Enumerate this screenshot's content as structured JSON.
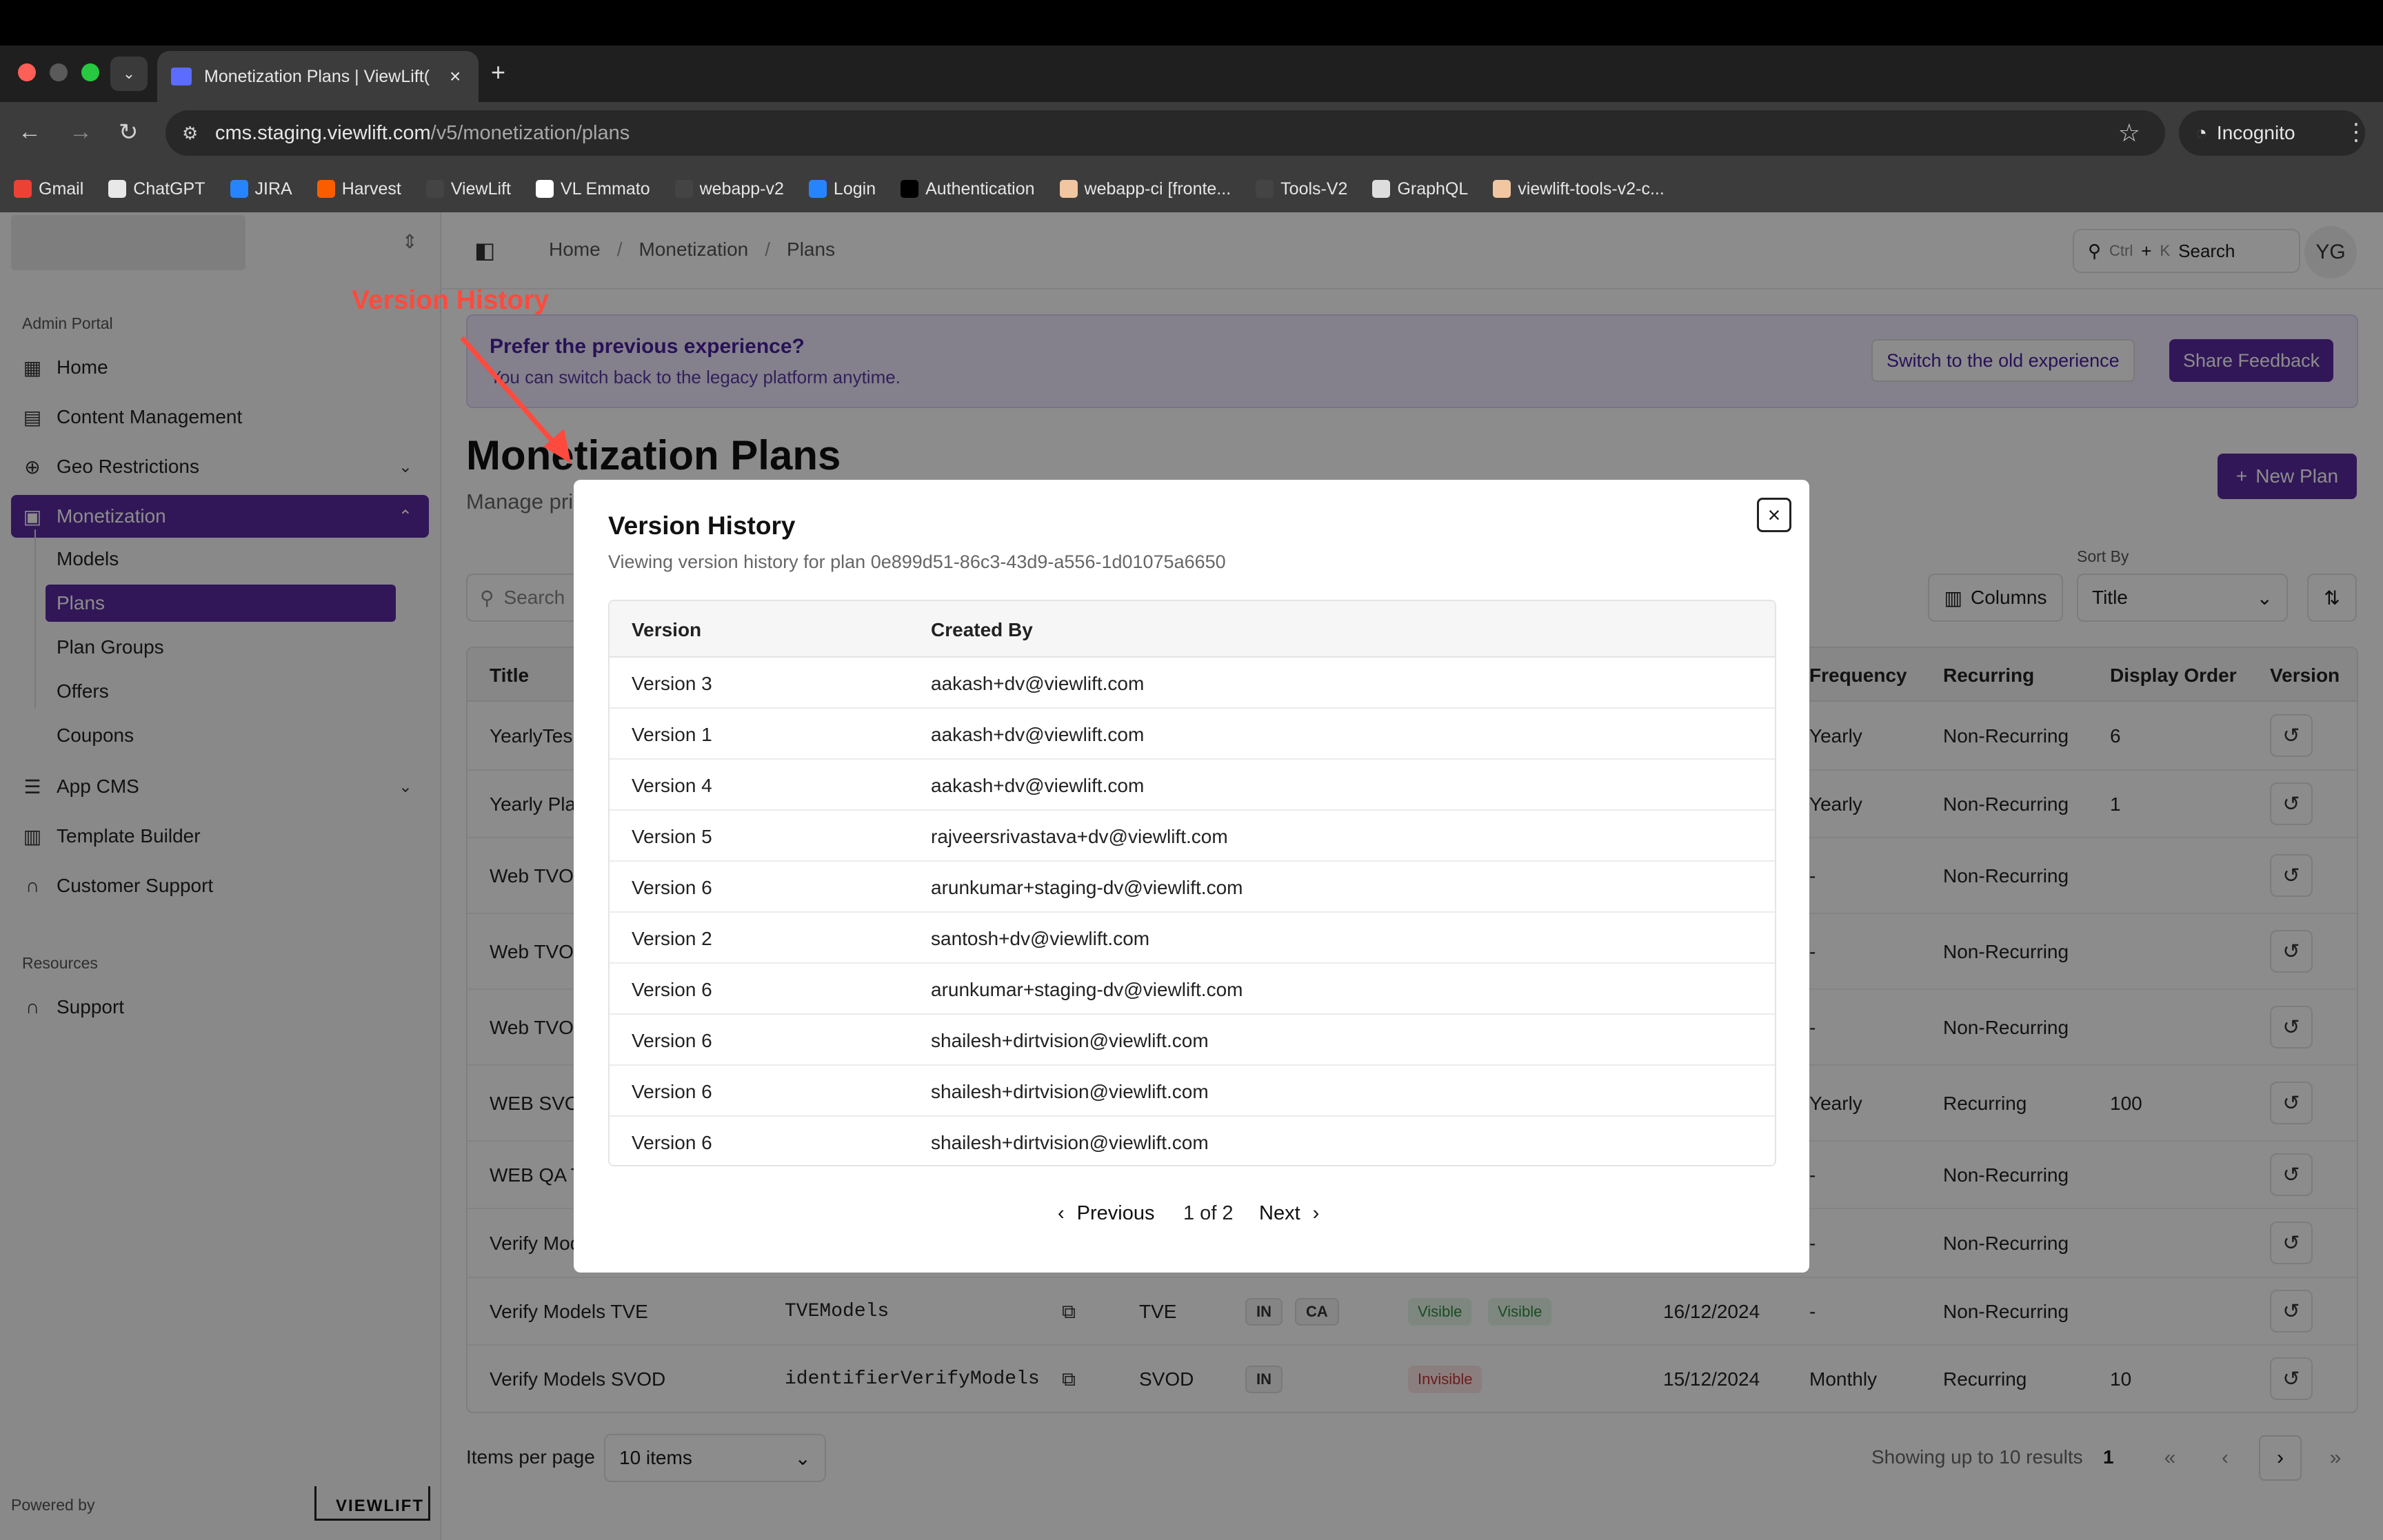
{
  "browser": {
    "tab_title": "Monetization Plans | ViewLift(",
    "url_host": "cms.staging.viewlift.com",
    "url_path": "/v5/monetization/plans",
    "incognito_label": "Incognito",
    "bookmarks": [
      {
        "label": "Gmail",
        "color": "#ea4335"
      },
      {
        "label": "ChatGPT",
        "color": "#e8e8e8"
      },
      {
        "label": "JIRA",
        "color": "#2684ff"
      },
      {
        "label": "Harvest",
        "color": "#fa5d00"
      },
      {
        "label": "ViewLift",
        "color": "#444444"
      },
      {
        "label": "VL Emmato",
        "color": "#ffffff"
      },
      {
        "label": "webapp-v2",
        "color": "#444444"
      },
      {
        "label": "Login",
        "color": "#2684ff"
      },
      {
        "label": "Authentication",
        "color": "#000000"
      },
      {
        "label": "webapp-ci [fronte...",
        "color": "#f2c6a0"
      },
      {
        "label": "Tools-V2",
        "color": "#444444"
      },
      {
        "label": "GraphQL",
        "color": "#dddddd"
      },
      {
        "label": "viewlift-tools-v2-c...",
        "color": "#f2c6a0"
      }
    ]
  },
  "sidebar": {
    "section_admin": "Admin Portal",
    "items": [
      {
        "label": "Home"
      },
      {
        "label": "Content Management"
      },
      {
        "label": "Geo Restrictions"
      },
      {
        "label": "Monetization"
      },
      {
        "label": "App CMS"
      },
      {
        "label": "Template Builder"
      },
      {
        "label": "Customer Support"
      }
    ],
    "sub_items": [
      "Models",
      "Plans",
      "Plan Groups",
      "Offers",
      "Coupons"
    ],
    "section_resources": "Resources",
    "support": "Support",
    "powered_by": "Powered by",
    "brand": "VIEWLIFT"
  },
  "header": {
    "breadcrumbs": [
      "Home",
      "Monetization",
      "Plans"
    ],
    "search_ctrl": "Ctrl",
    "search_plus": "+",
    "search_k": "K",
    "search_label": "Search",
    "avatar": "YG"
  },
  "banner": {
    "title": "Prefer the previous experience?",
    "subtitle": "You can switch back to the legacy platform anytime.",
    "switch_label": "Switch to the old experience",
    "feedback_label": "Share Feedback"
  },
  "page": {
    "title": "Monetization Plans",
    "subtitle": "Manage pri",
    "new_plan": "New Plan",
    "search_placeholder": "Search",
    "columns_label": "Columns",
    "sort_by_label": "Sort By",
    "sort_value": "Title"
  },
  "plans_table": {
    "headers": {
      "title": "Title",
      "frequency": "Frequency",
      "recurring": "Recurring",
      "display_order": "Display Order",
      "version": "Version"
    },
    "rows": [
      {
        "title": "YearlyTes",
        "identifier": "",
        "type": "",
        "countries": [],
        "visibility": [],
        "date": "",
        "frequency": "Yearly",
        "recurring": "Non-Recurring",
        "order": "6"
      },
      {
        "title": "Yearly Pla",
        "identifier": "",
        "type": "",
        "countries": [],
        "visibility": [],
        "date": "",
        "frequency": "Yearly",
        "recurring": "Non-Recurring",
        "order": "1"
      },
      {
        "title": "Web TVOD",
        "identifier": "",
        "type": "",
        "countries": [],
        "visibility": [],
        "date": "",
        "frequency": "-",
        "recurring": "Non-Recurring",
        "order": ""
      },
      {
        "title": "Web TVOD",
        "identifier": "",
        "type": "",
        "countries": [],
        "visibility": [],
        "date": "",
        "frequency": "-",
        "recurring": "Non-Recurring",
        "order": ""
      },
      {
        "title": "Web TVOD",
        "identifier": "",
        "type": "",
        "countries": [],
        "visibility": [],
        "date": "",
        "frequency": "-",
        "recurring": "Non-Recurring",
        "order": ""
      },
      {
        "title": "WEB SVOD",
        "identifier": "",
        "type": "",
        "countries": [],
        "visibility": [],
        "date": "",
        "frequency": "Yearly",
        "recurring": "Recurring",
        "order": "100"
      },
      {
        "title": "WEB QA T",
        "identifier": "",
        "type": "",
        "countries": [],
        "visibility": [],
        "date": "",
        "frequency": "-",
        "recurring": "Non-Recurring",
        "order": ""
      },
      {
        "title": "Verify Mod",
        "identifier": "",
        "type": "",
        "countries": [],
        "visibility": [],
        "date": "",
        "frequency": "-",
        "recurring": "Non-Recurring",
        "order": ""
      },
      {
        "title": "Verify Models TVE",
        "identifier": "TVEModels",
        "type": "TVE",
        "countries": [
          "IN",
          "CA"
        ],
        "visibility": [
          "Visible",
          "Visible"
        ],
        "date": "16/12/2024",
        "frequency": "-",
        "recurring": "Non-Recurring",
        "order": ""
      },
      {
        "title": "Verify Models SVOD",
        "identifier": "identifierVerifyModels",
        "type": "SVOD",
        "countries": [
          "IN"
        ],
        "visibility": [
          "Invisible"
        ],
        "date": "15/12/2024",
        "frequency": "Monthly",
        "recurring": "Recurring",
        "order": "10"
      }
    ]
  },
  "footer": {
    "items_per_page_label": "Items per page",
    "items_per_page_value": "10 items",
    "showing": "Showing up to 10 results",
    "current_page": "1"
  },
  "modal": {
    "title": "Version History",
    "subtitle": "Viewing version history for plan 0e899d51-86c3-43d9-a556-1d01075a6650",
    "col_version": "Version",
    "col_created_by": "Created By",
    "rows": [
      {
        "version": "Version 3",
        "created_by": "aakash+dv@viewlift.com"
      },
      {
        "version": "Version 1",
        "created_by": "aakash+dv@viewlift.com"
      },
      {
        "version": "Version 4",
        "created_by": "aakash+dv@viewlift.com"
      },
      {
        "version": "Version 5",
        "created_by": "rajveersrivastava+dv@viewlift.com"
      },
      {
        "version": "Version 6",
        "created_by": "arunkumar+staging-dv@viewlift.com"
      },
      {
        "version": "Version 2",
        "created_by": "santosh+dv@viewlift.com"
      },
      {
        "version": "Version 6",
        "created_by": "arunkumar+staging-dv@viewlift.com"
      },
      {
        "version": "Version 6",
        "created_by": "shailesh+dirtvision@viewlift.com"
      },
      {
        "version": "Version 6",
        "created_by": "shailesh+dirtvision@viewlift.com"
      },
      {
        "version": "Version 6",
        "created_by": "shailesh+dirtvision@viewlift.com"
      }
    ],
    "previous": "Previous",
    "page_info": "1 of 2",
    "next": "Next"
  },
  "annotation": {
    "label": "Version History",
    "color": "#ff4a3d"
  },
  "colors": {
    "brand": "#5a2aa0",
    "banner_bg": "#f1ecff"
  }
}
